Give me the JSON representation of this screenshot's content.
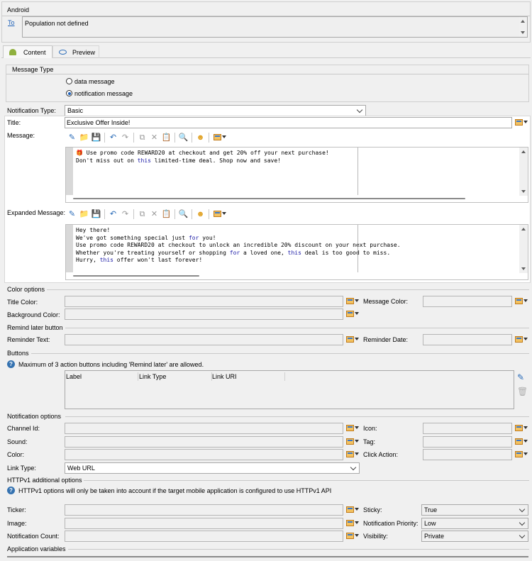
{
  "header": {
    "title": "Android"
  },
  "to": {
    "link": "To",
    "value": "Population not defined"
  },
  "tabs": [
    {
      "label": "Content"
    },
    {
      "label": "Preview"
    }
  ],
  "message_type": {
    "title": "Message Type",
    "options": [
      {
        "label": "data message",
        "selected": false
      },
      {
        "label": "notification message",
        "selected": true
      }
    ]
  },
  "notification_type": {
    "label": "Notification Type:",
    "value": "Basic"
  },
  "title_field": {
    "label": "Title:",
    "value": "Exclusive Offer Inside!"
  },
  "message": {
    "label": "Message:",
    "lines": [
      "🎁 Use promo code REWARD20 at checkout and get 20% off your next purchase!",
      "Don't miss out on this limited-time deal. Shop now and save!"
    ]
  },
  "expanded_message": {
    "label": "Expanded Message:",
    "lines": [
      "Hey there!",
      "We've got something special just for you!",
      "Use promo code REWARD20 at checkout to unlock an incredible 20% discount on your next purchase.",
      "Whether you're treating yourself or shopping for a loved one, this deal is too good to miss.",
      "Hurry, this offer won't last forever!"
    ]
  },
  "color_options": {
    "title": "Color options",
    "title_color": "Title Color:",
    "message_color": "Message Color:",
    "background_color": "Background Color:"
  },
  "remind_later": {
    "title": "Remind later button",
    "reminder_text": "Reminder Text:",
    "reminder_date": "Reminder Date:"
  },
  "buttons": {
    "title": "Buttons",
    "info": "Maximum of 3 action buttons including 'Remind later' are allowed.",
    "columns": [
      "Label",
      "Link Type",
      "Link URI"
    ]
  },
  "notification_options": {
    "title": "Notification options",
    "channel_id": "Channel Id:",
    "icon": "Icon:",
    "sound": "Sound:",
    "tag": "Tag:",
    "color": "Color:",
    "click_action": "Click Action:",
    "link_type": {
      "label": "Link Type:",
      "value": "Web URL"
    }
  },
  "httpv1": {
    "title": "HTTPv1 additional options",
    "info": "HTTPv1 options will only be taken into account if the target mobile application is configured to use HTTPv1 API",
    "ticker": "Ticker:",
    "image": "Image:",
    "notification_count": "Notification Count:",
    "sticky": {
      "label": "Sticky:",
      "value": "True"
    },
    "priority": {
      "label": "Notification Priority:",
      "value": "Low"
    },
    "visibility": {
      "label": "Visibility:",
      "value": "Private"
    }
  },
  "app_variables": {
    "title": "Application variables"
  },
  "colors": {
    "accent": "#1c5fb8",
    "keyword": "#1a1aa6",
    "highlight_bg": "#ffffff"
  }
}
